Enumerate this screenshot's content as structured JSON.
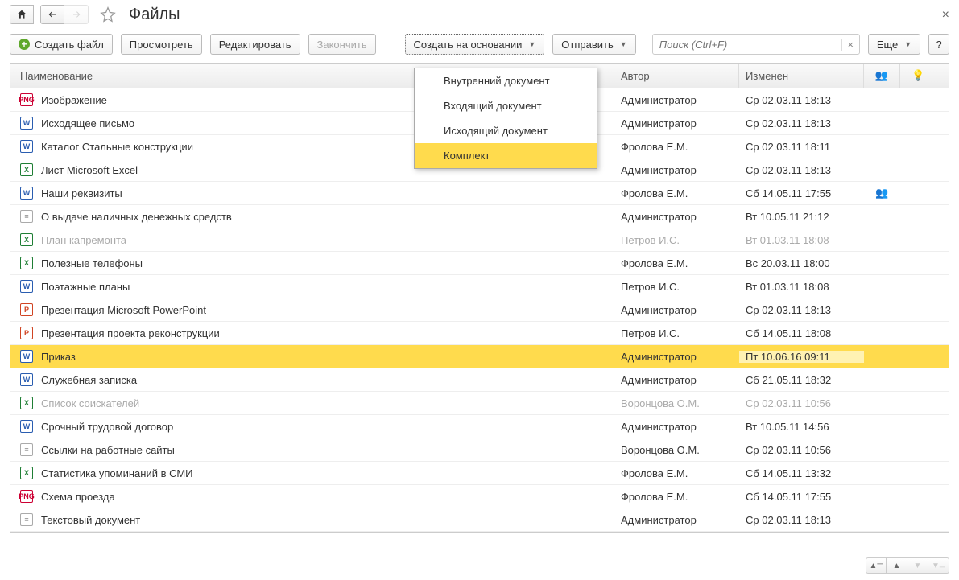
{
  "title": "Файлы",
  "toolbar": {
    "create_file": "Создать файл",
    "view": "Просмотреть",
    "edit": "Редактировать",
    "finish": "Закончить",
    "create_based_on": "Создать на основании",
    "send": "Отправить",
    "more": "Еще",
    "help": "?"
  },
  "search": {
    "placeholder": "Поиск (Ctrl+F)",
    "clear": "×"
  },
  "dropdown": {
    "items": [
      "Внутренний документ",
      "Входящий документ",
      "Исходящий документ",
      "Комплект"
    ],
    "highlighted": 3
  },
  "columns": {
    "name": "Наименование",
    "author": "Автор",
    "changed": "Изменен"
  },
  "rows": [
    {
      "icon": "png",
      "name": "Изображение",
      "author": "Администратор",
      "date": "Ср 02.03.11 18:13",
      "dim": false,
      "sel": false,
      "signed": false
    },
    {
      "icon": "doc",
      "name": "Исходящее письмо",
      "author": "Администратор",
      "date": "Ср 02.03.11 18:13",
      "dim": false,
      "sel": false,
      "signed": false
    },
    {
      "icon": "doc",
      "name": "Каталог Стальные конструкции",
      "author": "Фролова Е.М.",
      "date": "Ср 02.03.11 18:11",
      "dim": false,
      "sel": false,
      "signed": false
    },
    {
      "icon": "xls",
      "name": "Лист Microsoft Excel",
      "author": "Администратор",
      "date": "Ср 02.03.11 18:13",
      "dim": false,
      "sel": false,
      "signed": false
    },
    {
      "icon": "doc",
      "name": "Наши реквизиты",
      "author": "Фролова Е.М.",
      "date": "Сб 14.05.11 17:55",
      "dim": false,
      "sel": false,
      "signed": true
    },
    {
      "icon": "txt",
      "name": "О выдаче наличных денежных средств",
      "author": "Администратор",
      "date": "Вт 10.05.11 21:12",
      "dim": false,
      "sel": false,
      "signed": false
    },
    {
      "icon": "xls",
      "name": "План капремонта",
      "author": "Петров И.С.",
      "date": "Вт 01.03.11 18:08",
      "dim": true,
      "sel": false,
      "signed": false
    },
    {
      "icon": "xls",
      "name": "Полезные телефоны",
      "author": "Фролова Е.М.",
      "date": "Вс 20.03.11 18:00",
      "dim": false,
      "sel": false,
      "signed": false
    },
    {
      "icon": "doc",
      "name": "Поэтажные планы",
      "author": "Петров И.С.",
      "date": "Вт 01.03.11 18:08",
      "dim": false,
      "sel": false,
      "signed": false
    },
    {
      "icon": "ppt",
      "name": "Презентация Microsoft PowerPoint",
      "author": "Администратор",
      "date": "Ср 02.03.11 18:13",
      "dim": false,
      "sel": false,
      "signed": false
    },
    {
      "icon": "ppt",
      "name": "Презентация проекта реконструкции",
      "author": "Петров И.С.",
      "date": "Сб 14.05.11 18:08",
      "dim": false,
      "sel": false,
      "signed": false
    },
    {
      "icon": "doc",
      "name": "Приказ",
      "author": "Администратор",
      "date": "Пт 10.06.16 09:11",
      "dim": false,
      "sel": true,
      "signed": false
    },
    {
      "icon": "doc",
      "name": "Служебная записка",
      "author": "Администратор",
      "date": "Сб 21.05.11 18:32",
      "dim": false,
      "sel": false,
      "signed": false
    },
    {
      "icon": "xls",
      "name": "Список соискателей",
      "author": "Воронцова О.М.",
      "date": "Ср 02.03.11 10:56",
      "dim": true,
      "sel": false,
      "signed": false
    },
    {
      "icon": "doc",
      "name": "Срочный трудовой договор",
      "author": "Администратор",
      "date": "Вт 10.05.11 14:56",
      "dim": false,
      "sel": false,
      "signed": false
    },
    {
      "icon": "txt",
      "name": "Ссылки на работные сайты",
      "author": "Воронцова О.М.",
      "date": "Ср 02.03.11 10:56",
      "dim": false,
      "sel": false,
      "signed": false
    },
    {
      "icon": "xls",
      "name": "Статистика упоминаний в СМИ",
      "author": "Фролова Е.М.",
      "date": "Сб 14.05.11 13:32",
      "dim": false,
      "sel": false,
      "signed": false
    },
    {
      "icon": "png",
      "name": "Схема проезда",
      "author": "Фролова Е.М.",
      "date": "Сб 14.05.11 17:55",
      "dim": false,
      "sel": false,
      "signed": false
    },
    {
      "icon": "txt",
      "name": "Текстовый документ",
      "author": "Администратор",
      "date": "Ср 02.03.11 18:13",
      "dim": false,
      "sel": false,
      "signed": false
    }
  ]
}
